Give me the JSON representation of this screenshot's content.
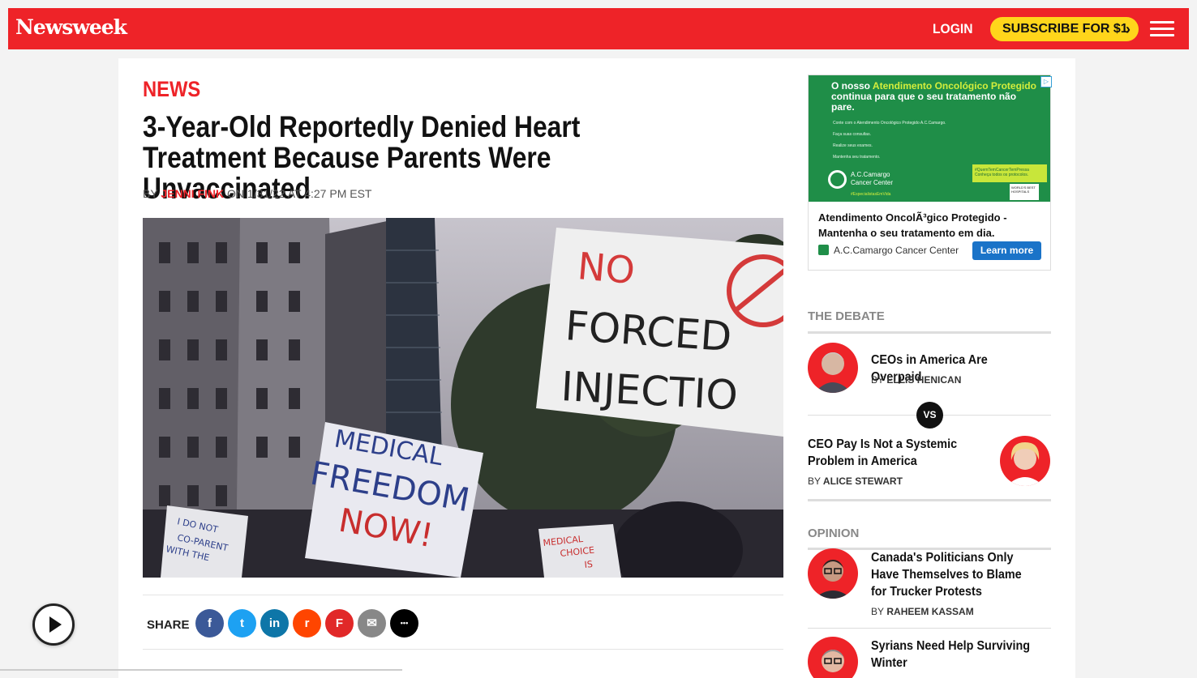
{
  "header": {
    "logo": "Newsweek",
    "login": "LOGIN",
    "subscribe": "SUBSCRIBE FOR $1",
    "subscribe_chevron": "›",
    "menu_icon": "hamburger-icon"
  },
  "article": {
    "section": "NEWS",
    "headline": "3-Year-Old Reportedly Denied Heart Treatment Because Parents Were Unvaccinated",
    "byline_prefix": "BY",
    "author": "JENNI FINK",
    "byline_date": "ON 1/31/22 AT 4:27 PM EST",
    "image_signs": {
      "sign1_line1": "NO",
      "sign1_line2": "FORCED",
      "sign1_line3": "INJECTIO",
      "sign2_line1": "MEDICAL",
      "sign2_line2": "FREEDOM",
      "sign2_line3": "NOW!",
      "sign3_line1": "I DO NOT",
      "sign3_line2": "CO-PARENT",
      "sign3_line3": "WITH THE",
      "sign4_line1": "MEDICAL",
      "sign4_line2": "CHOICE",
      "sign4_line3": "IS"
    },
    "share_label": "SHARE",
    "share_buttons": [
      {
        "icon": "facebook-icon",
        "glyph": "f",
        "color": "#3b5998"
      },
      {
        "icon": "twitter-icon",
        "glyph": "t",
        "color": "#1da1f2"
      },
      {
        "icon": "linkedin-icon",
        "glyph": "in",
        "color": "#0e76a8"
      },
      {
        "icon": "reddit-icon",
        "glyph": "r",
        "color": "#ff4500"
      },
      {
        "icon": "flipboard-icon",
        "glyph": "F",
        "color": "#e12828"
      },
      {
        "icon": "email-icon",
        "glyph": "✉",
        "color": "#888888"
      },
      {
        "icon": "comment-icon",
        "glyph": "•••",
        "color": "#000000"
      }
    ]
  },
  "ad": {
    "info": "▷",
    "headline_a": "O nosso ",
    "headline_highlight": "Atendimento Oncológico Protegido",
    "headline_b": " continua para que o seu tratamento não pare.",
    "list": [
      "Conte com o Atendimento Oncológico Protegido A.C.Camargo.",
      "Faça suas consultas.",
      "Realize seus exames.",
      "Mantenha seu tratamento."
    ],
    "logo_name": "A.C.Camargo",
    "logo_sub": "Cancer Center",
    "tag": "#QuemTemCancerTemPressa",
    "tag_sub": "Conheça todos os protocolos.",
    "hashtag": "#EspecialistasEmVida",
    "badge": "WORLD'S BEST HOSPITALS",
    "body": "Atendimento OncolÃ³gico Protegido - Mantenha o seu tratamento em dia.",
    "sponsor": "A.C.Camargo Cancer Center",
    "cta": "Learn more"
  },
  "sidebar": {
    "debate_heading": "THE DEBATE",
    "debate_items": [
      {
        "title": "CEOs in America Are Overpaid",
        "by": "BY",
        "author": "ELLIS HENICAN"
      },
      {
        "title": "CEO Pay Is Not a Systemic Problem in America",
        "by": "BY",
        "author": "ALICE STEWART"
      }
    ],
    "vs": "VS",
    "opinion_heading": "OPINION",
    "opinion_items": [
      {
        "title": "Canada's Politicians Only Have Themselves to Blame for Trucker Protests",
        "by": "BY",
        "author": "RAHEEM KASSAM"
      },
      {
        "title": "Syrians Need Help Surviving Winter",
        "by": "",
        "author": ""
      }
    ]
  },
  "player": {
    "icon": "play-icon"
  }
}
